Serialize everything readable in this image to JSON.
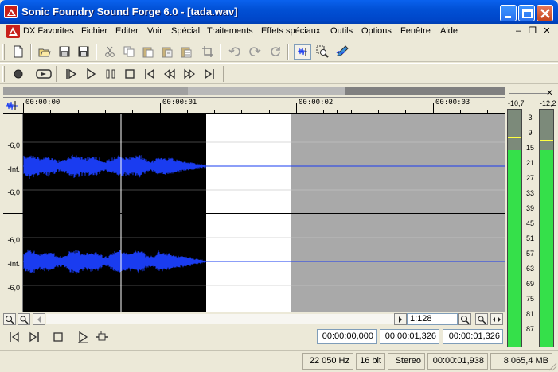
{
  "window": {
    "title": "Sonic Foundry Sound Forge 6.0 - [tada.wav]"
  },
  "menu": {
    "items": [
      {
        "label": "DX Favorites"
      },
      {
        "label": "Fichier"
      },
      {
        "label": "Editer"
      },
      {
        "label": "Voir"
      },
      {
        "label": "Spécial"
      },
      {
        "label": "Traitements"
      },
      {
        "label": "Effets spéciaux"
      },
      {
        "label": "Outils"
      },
      {
        "label": "Options"
      },
      {
        "label": "Fenêtre"
      },
      {
        "label": "Aide"
      }
    ],
    "mdi": {
      "minimize": "–",
      "restore": "❐",
      "close": "✕"
    }
  },
  "ruler": {
    "labels": [
      "00:00:00",
      "00:00:01",
      "00:00:02",
      "00:00:03"
    ]
  },
  "channels": {
    "labels": [
      "-6,0",
      "-Inf.",
      "-6,0",
      "-6,0",
      "-Inf.",
      "-6,0"
    ]
  },
  "zoom": {
    "ratio": "1:128"
  },
  "transport": {
    "selection_start": "00:00:00,000",
    "selection_end": "00:00:01,326",
    "selection_length": "00:00:01,326"
  },
  "meters": {
    "peak_left": "-10,7",
    "peak_right": "-12,2",
    "scale": [
      "3",
      "9",
      "15",
      "21",
      "27",
      "33",
      "39",
      "45",
      "51",
      "57",
      "63",
      "69",
      "75",
      "81",
      "87"
    ],
    "left_level": 0.83,
    "right_level": 0.83,
    "fill_color": "#35e04a"
  },
  "status": {
    "sample_rate": "22 050 Hz",
    "bit_depth": "16 bit",
    "channels": "Stereo",
    "length": "00:00:01,938",
    "free_space": "8 065,4 MB"
  },
  "colors": {
    "waveform": "#1a3cf0",
    "background": "#000000",
    "selection": "#ffffff",
    "outside": "#a9a9a9"
  }
}
